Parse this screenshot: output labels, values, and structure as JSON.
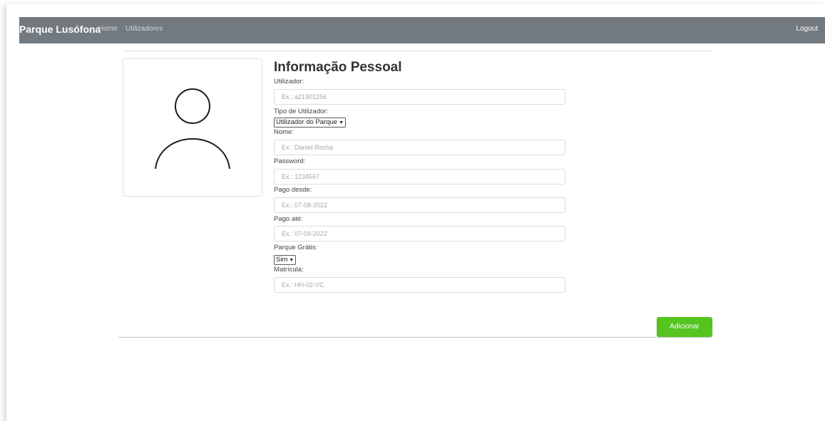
{
  "navbar": {
    "brand": "Parque Lusófona",
    "links": [
      "Home",
      "Utilizadores"
    ],
    "logout": "Logout"
  },
  "form": {
    "title": "Informação Pessoal",
    "utilizador": {
      "label": "Utilizador:",
      "placeholder": "Ex.: a21901256"
    },
    "tipo": {
      "label": "Tipo de Utilizador:",
      "selected": "Utilizador do Parque"
    },
    "nome": {
      "label": "Nome:",
      "placeholder": "Ex.: Daniel Rocha"
    },
    "password": {
      "label": "Password:",
      "placeholder": "Ex.: 1234567"
    },
    "pago_desde": {
      "label": "Pago desde:",
      "placeholder": "Ex.: 07-08-2022"
    },
    "pago_ate": {
      "label": "Pago até:",
      "placeholder": "Ex.: 07-09-2022"
    },
    "parque_gratis": {
      "label": "Parque Grátis:",
      "selected": "Sim"
    },
    "matricula": {
      "label": "Matrícula:",
      "placeholder": "Ex.: HH-02-VC"
    },
    "submit_label": "Adicionar"
  },
  "icons": {
    "avatar": "user-avatar-icon"
  }
}
